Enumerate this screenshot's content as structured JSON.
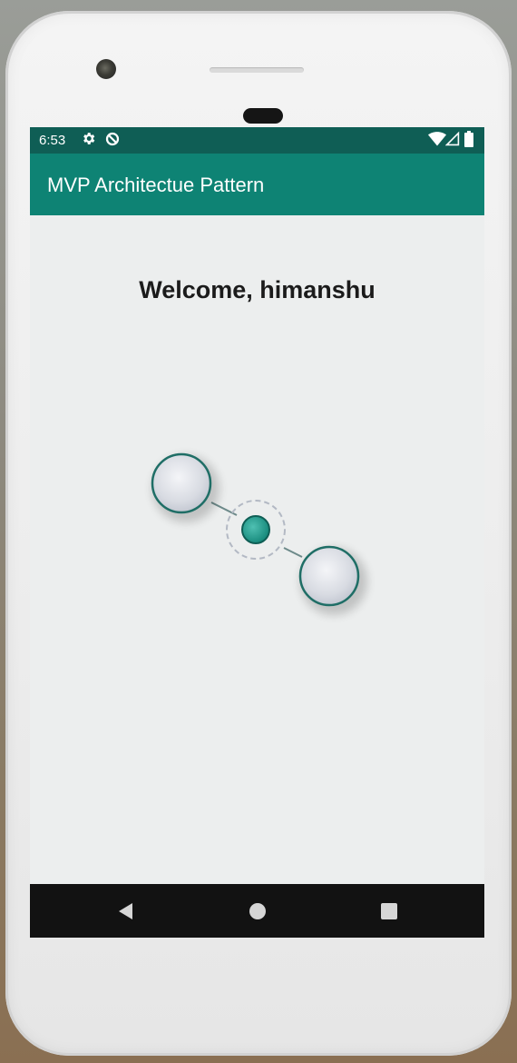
{
  "status_bar": {
    "time": "6:53",
    "icons": [
      "gear-icon",
      "data-saver-icon",
      "wifi-icon",
      "signal-icon",
      "battery-icon"
    ]
  },
  "app_bar": {
    "title": "MVP Architectue Pattern"
  },
  "content": {
    "welcome_text": "Welcome, himanshu"
  },
  "nav_bar": {
    "buttons": [
      "back-icon",
      "home-icon",
      "recents-icon"
    ]
  },
  "colors": {
    "status_bar": "#0f5e55",
    "app_bar": "#0e8374",
    "accent": "#1a9a8a",
    "background": "#eceeee"
  }
}
